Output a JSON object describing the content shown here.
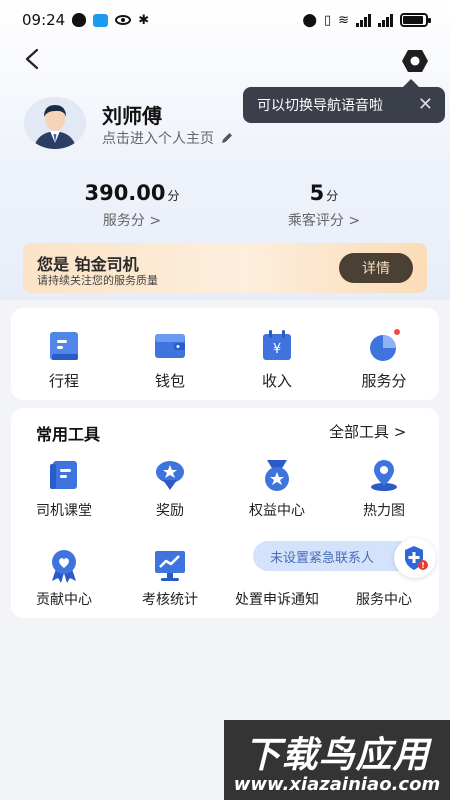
{
  "status_bar": {
    "time": "09:24"
  },
  "header": {
    "tooltip_text": "可以切换导航语音啦"
  },
  "profile": {
    "name": "刘师傅",
    "profile_link": "点击进入个人主页"
  },
  "stats": [
    {
      "value": "390.00",
      "unit": "分",
      "label": "服务分 >"
    },
    {
      "value": "5",
      "unit": "分",
      "label": "乘客评分 >"
    }
  ],
  "banner": {
    "title": "您是 铂金司机",
    "subtitle": "请持续关注您的服务质量",
    "button": "详情"
  },
  "quick_actions": [
    {
      "label": "行程",
      "icon": "trip-icon"
    },
    {
      "label": "钱包",
      "icon": "wallet-icon"
    },
    {
      "label": "收入",
      "icon": "income-icon"
    },
    {
      "label": "服务分",
      "icon": "service-score-icon"
    }
  ],
  "tools": {
    "title": "常用工具",
    "all_label": "全部工具 >",
    "items": [
      {
        "label": "司机课堂",
        "icon": "driver-class-icon"
      },
      {
        "label": "奖励",
        "icon": "reward-icon"
      },
      {
        "label": "权益中心",
        "icon": "benefits-icon"
      },
      {
        "label": "热力图",
        "icon": "heatmap-icon"
      },
      {
        "label": "贡献中心",
        "icon": "contribution-icon"
      },
      {
        "label": "考核统计",
        "icon": "assessment-icon"
      },
      {
        "label": "处置申诉通知",
        "icon": "appeal-icon"
      },
      {
        "label": "服务中心",
        "icon": "service-center-icon"
      }
    ]
  },
  "emergency": {
    "pill_text": "未设置紧急联系人"
  },
  "watermark": {
    "line1": "下载鸟应用",
    "line2": "www.xiazainiao.com"
  },
  "colors": {
    "accent_blue": "#3b6fd8",
    "banner_button": "#4a4033",
    "page_bg": "#f2f4f7"
  }
}
